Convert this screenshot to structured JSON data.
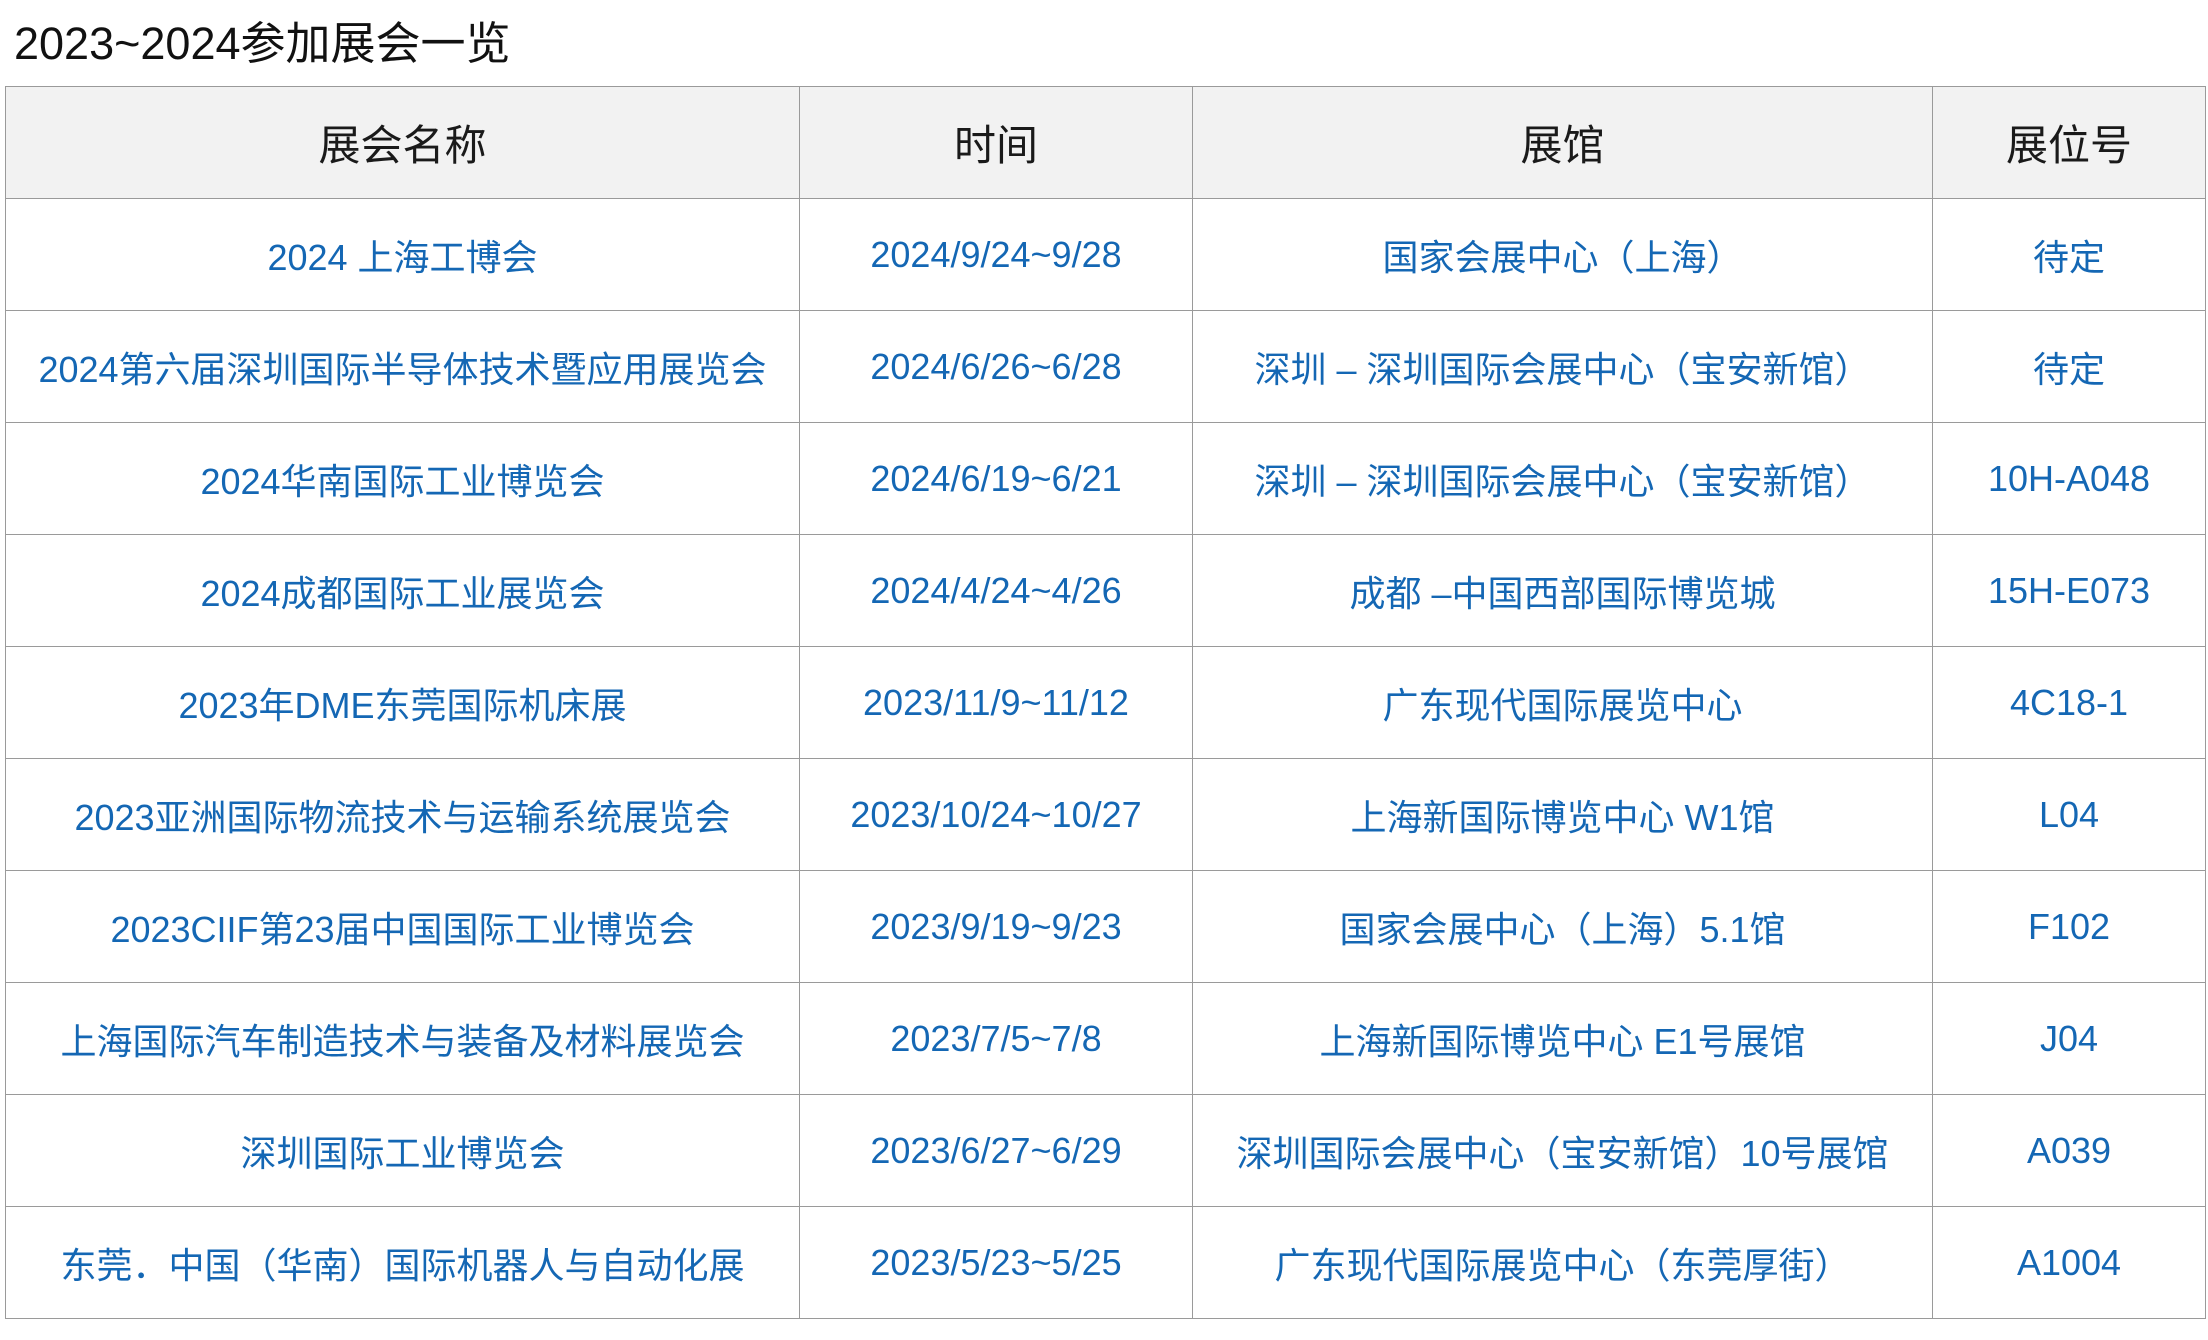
{
  "page": {
    "title": "2023~2024参加展会一览"
  },
  "table": {
    "headers": {
      "name": "展会名称",
      "time": "时间",
      "hall": "展馆",
      "booth": "展位号"
    },
    "rows": [
      {
        "name": "2024 上海工博会",
        "time": "2024/9/24~9/28",
        "hall": "国家会展中心（上海）",
        "booth": "待定"
      },
      {
        "name": "2024第六届深圳国际半导体技术暨应用展览会",
        "time": "2024/6/26~6/28",
        "hall": "深圳 – 深圳国际会展中心（宝安新馆）",
        "booth": "待定"
      },
      {
        "name": "2024华南国际工业博览会",
        "time": "2024/6/19~6/21",
        "hall": "深圳 – 深圳国际会展中心（宝安新馆）",
        "booth": "10H-A048"
      },
      {
        "name": "2024成都国际工业展览会",
        "time": "2024/4/24~4/26",
        "hall": "成都 –中国西部国际博览城",
        "booth": "15H-E073"
      },
      {
        "name": "2023年DME东莞国际机床展",
        "time": "2023/11/9~11/12",
        "hall": "广东现代国际展览中心",
        "booth": "4C18-1"
      },
      {
        "name": "2023亚洲国际物流技术与运输系统展览会",
        "time": "2023/10/24~10/27",
        "hall": "上海新国际博览中心  W1馆",
        "booth": "L04"
      },
      {
        "name": "2023CIIF第23届中国国际工业博览会",
        "time": "2023/9/19~9/23",
        "hall": "国家会展中心（上海）5.1馆",
        "booth": "F102"
      },
      {
        "name": "上海国际汽车制造技术与装备及材料展览会",
        "time": "2023/7/5~7/8",
        "hall": "上海新国际博览中心  E1号展馆",
        "booth": "J04"
      },
      {
        "name": "深圳国际工业博览会",
        "time": "2023/6/27~6/29",
        "hall": "深圳国际会展中心（宝安新馆）10号展馆",
        "booth": "A039"
      },
      {
        "name": "东莞．中国（华南）国际机器人与自动化展",
        "time": "2023/5/23~5/25",
        "hall": "广东现代国际展览中心（东莞厚街）",
        "booth": "A1004"
      }
    ]
  },
  "colors": {
    "link_text": "#1467b4",
    "header_bg": "#f2f2f2",
    "border": "#9a9a9a"
  }
}
